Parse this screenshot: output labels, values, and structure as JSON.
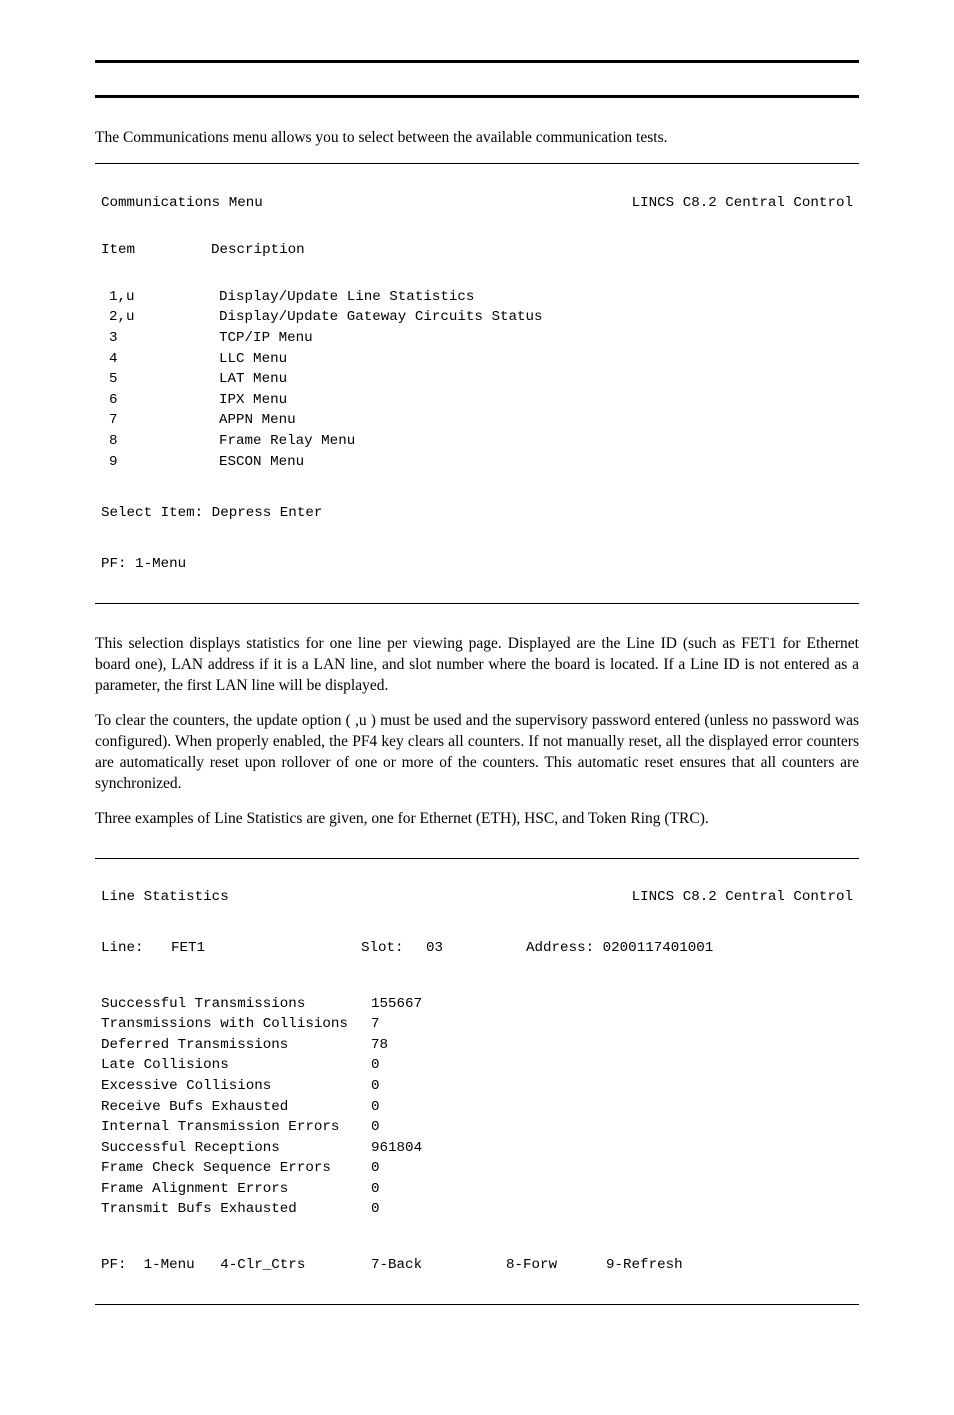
{
  "intro_text": "The Communications menu allows you to select between the available communication tests.",
  "menu": {
    "title": "Communications Menu",
    "system": "LINCS C8.2 Central Control",
    "col1": "Item",
    "col2": "Description",
    "rows": [
      {
        "item": "1,u",
        "desc": "Display/Update Line Statistics"
      },
      {
        "item": "2,u",
        "desc": "Display/Update Gateway Circuits Status"
      },
      {
        "item": "3",
        "desc": "TCP/IP Menu"
      },
      {
        "item": "4",
        "desc": "LLC Menu"
      },
      {
        "item": "5",
        "desc": "LAT Menu"
      },
      {
        "item": "6",
        "desc": "IPX Menu"
      },
      {
        "item": "7",
        "desc": "APPN Menu"
      },
      {
        "item": "8",
        "desc": "Frame Relay Menu"
      },
      {
        "item": "9",
        "desc": "ESCON Menu"
      }
    ],
    "select": "Select Item: Depress Enter",
    "pf": "PF: 1-Menu"
  },
  "para1": "This selection displays statistics for one line per viewing page. Displayed are the Line ID (such as FET1 for Ethernet board one), LAN address if it is a LAN line, and slot number where the board is located. If a Line ID is not entered as a parameter, the first LAN line will be displayed.",
  "para2": "To clear the counters, the update option ( ,u ) must be used and the supervisory password entered (unless no password was configured). When properly enabled, the PF4 key clears all counters. If not manually reset, all the displayed error counters are automatically reset upon rollover of one or more of the counters. This automatic reset ensures that all counters are synchronized.",
  "para3": "Three examples of Line Statistics are given, one for Ethernet (ETH), HSC, and Token Ring (TRC).",
  "chart_data": {
    "type": "table",
    "title": "Line Statistics",
    "system": "LINCS C8.2 Central Control",
    "line_label": "Line:",
    "line_value": "FET1",
    "slot_label": "Slot:",
    "slot_value": "03",
    "addr_label": "Address:",
    "addr_value": "0200117401001",
    "rows": [
      {
        "label": "Successful Transmissions",
        "value": "155667"
      },
      {
        "label": "Transmissions with Collisions",
        "value": "7"
      },
      {
        "label": "Deferred Transmissions",
        "value": "78"
      },
      {
        "label": "Late Collisions",
        "value": "0"
      },
      {
        "label": "Excessive Collisions",
        "value": "0"
      },
      {
        "label": "Receive Bufs Exhausted",
        "value": "0"
      },
      {
        "label": "Internal Transmission Errors",
        "value": "0"
      },
      {
        "label": "Successful Receptions",
        "value": "961804"
      },
      {
        "label": "Frame Check Sequence Errors",
        "value": "0"
      },
      {
        "label": "Frame Alignment Errors",
        "value": "0"
      },
      {
        "label": "Transmit Bufs Exhausted",
        "value": "0"
      }
    ],
    "pf": {
      "left": "PF:  1-Menu   4-Clr_Ctrs",
      "back": "7-Back",
      "forw": "8-Forw",
      "refresh": "9-Refresh"
    }
  }
}
